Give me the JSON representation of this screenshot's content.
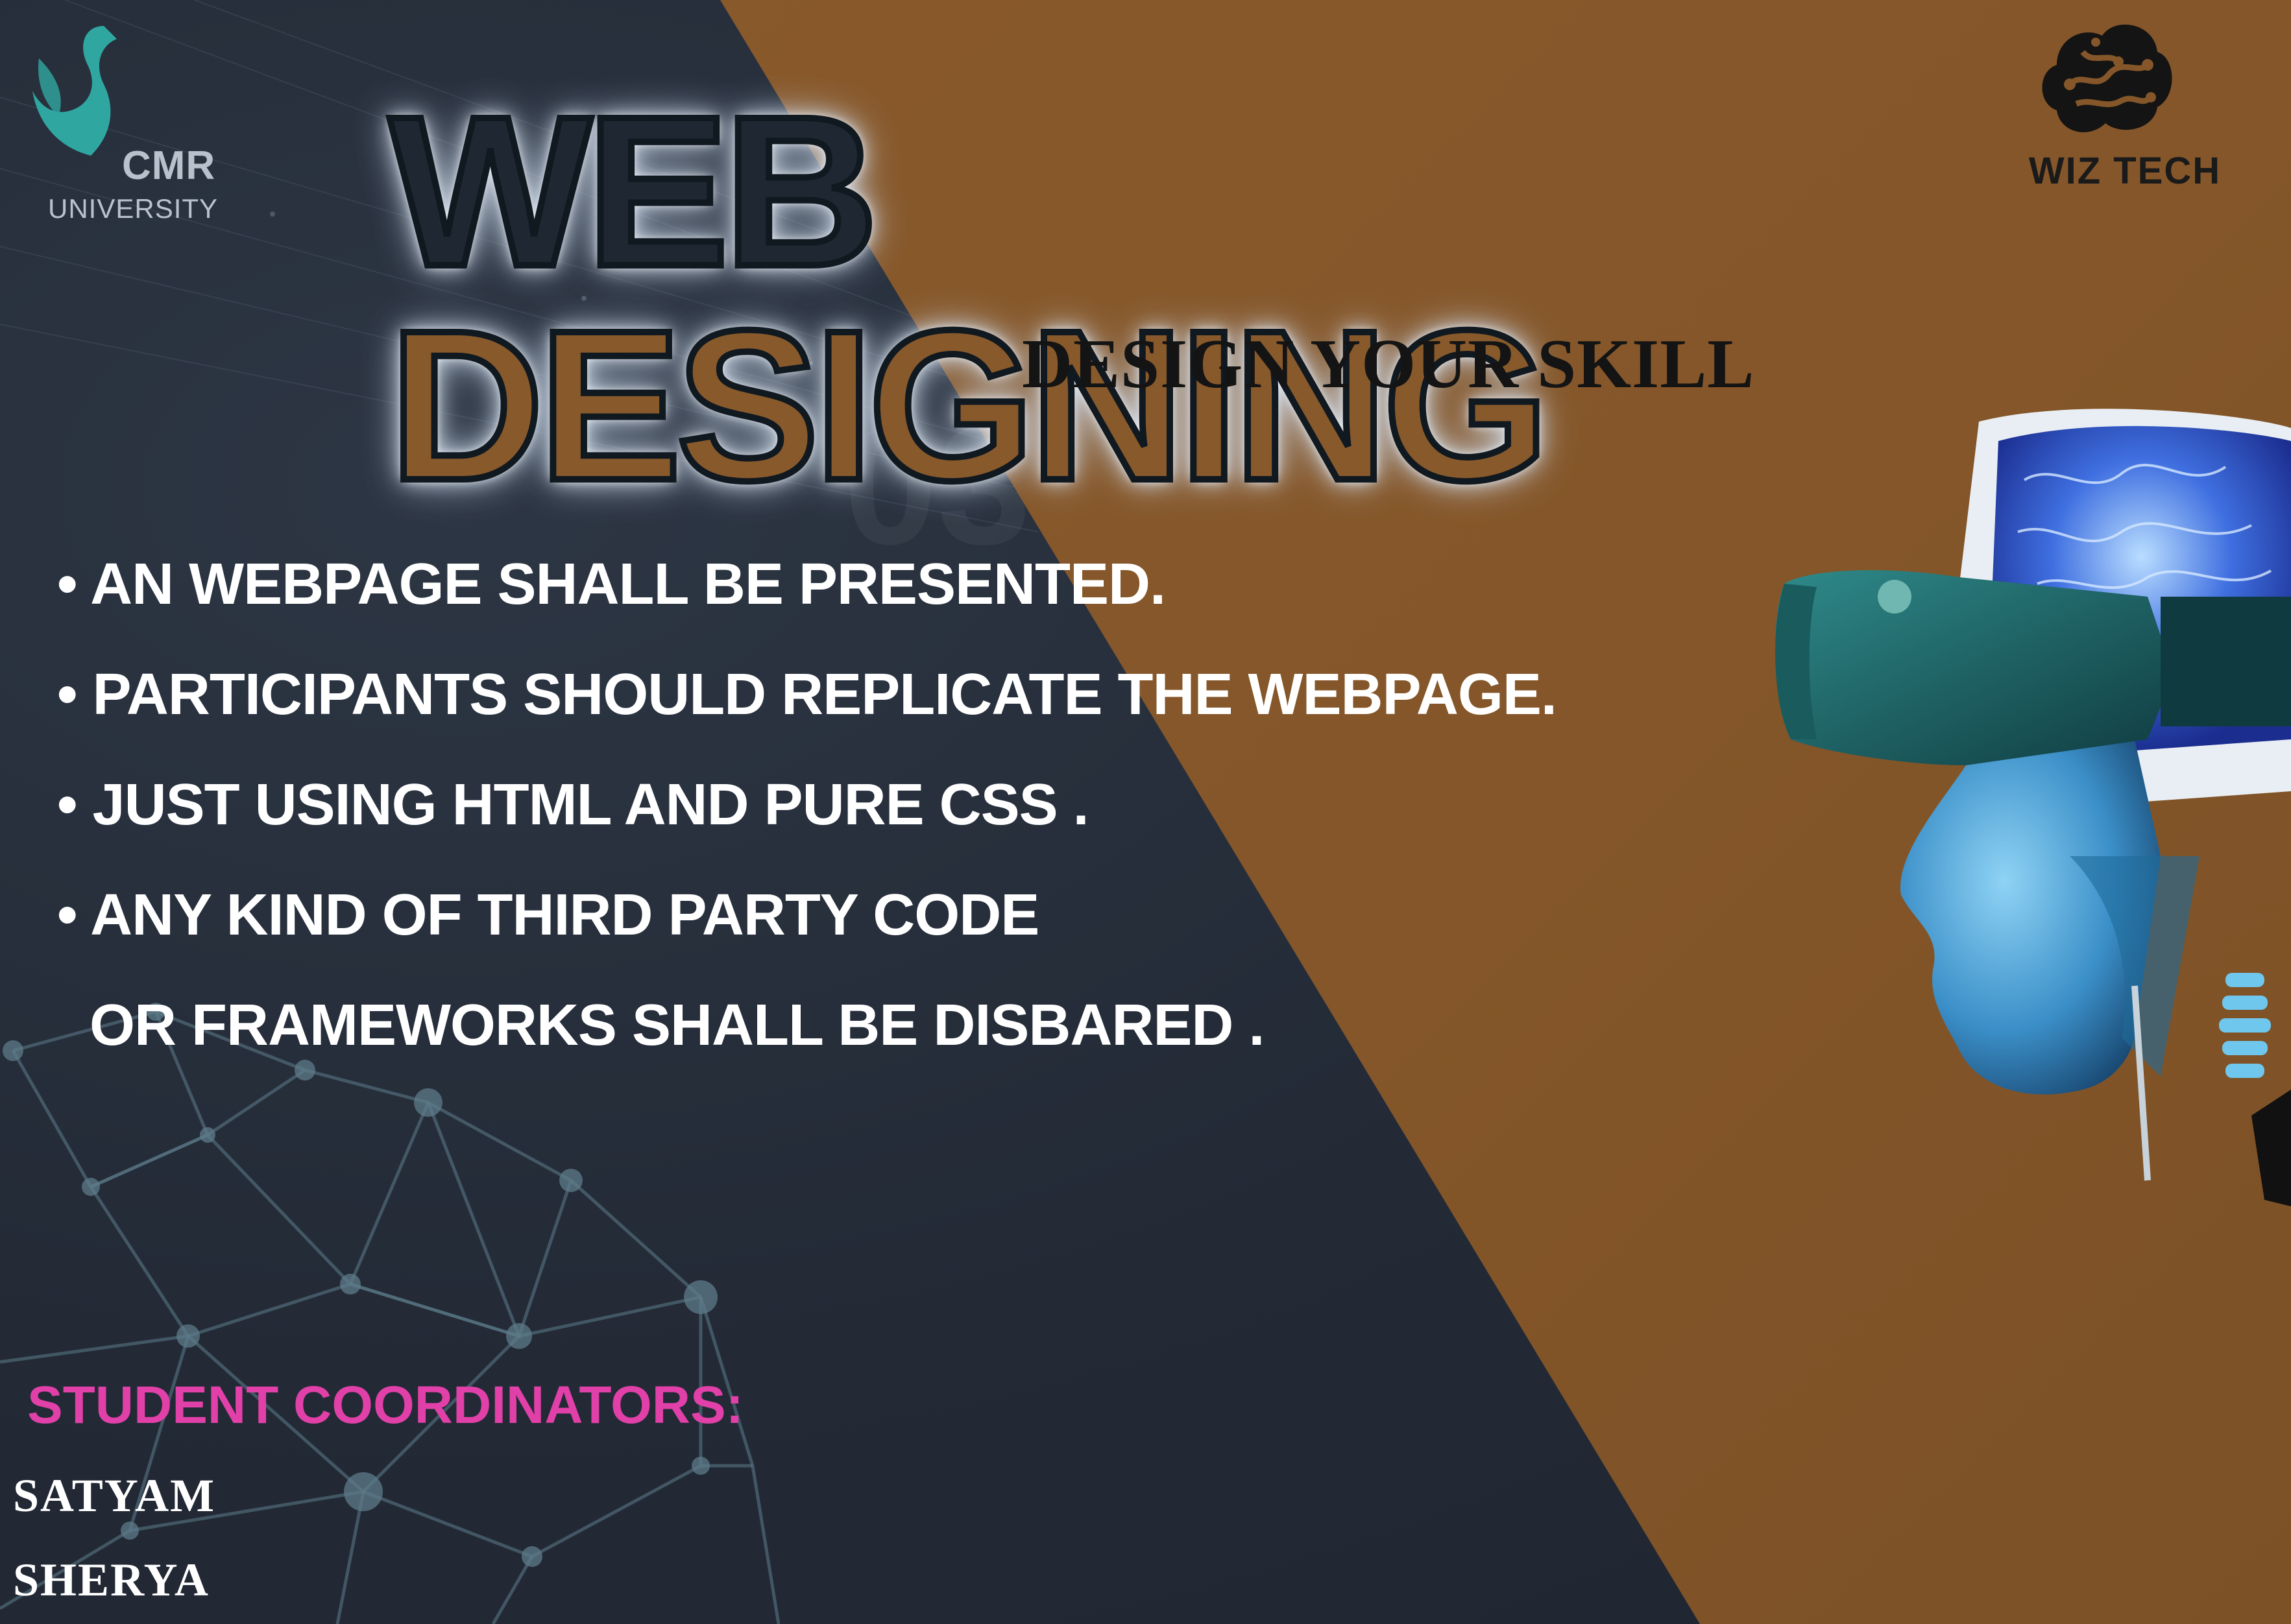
{
  "brand": {
    "left_logo": {
      "name": "CMR",
      "sub": "UNIVERSITY"
    },
    "right_logo": {
      "name": "WIZ TECH"
    }
  },
  "title": {
    "word1": "WEB",
    "word2": "DESIGNING"
  },
  "subtitle": "DESIGN YOUR SKILL",
  "rules": [
    "• AN WEBPAGE SHALL BE PRESENTED.",
    "• PARTICIPANTS SHOULD REPLICATE THE WEBPAGE.",
    "• JUST USING HTML AND PURE CSS .",
    "• ANY KIND OF THIRD PARTY CODE",
    "OR FRAMEWORKS SHALL BE DISBARED ."
  ],
  "coordinators": {
    "heading": "STUDENT COORDINATORS:",
    "names": [
      "SATYAM",
      "SHERYA"
    ]
  },
  "colors": {
    "dark_panel": "#232a36",
    "brown_panel": "#845629",
    "accent_pink": "#e040a8",
    "cmr_teal": "#2fa7a0",
    "robot_blue": "#4fb3e8"
  }
}
